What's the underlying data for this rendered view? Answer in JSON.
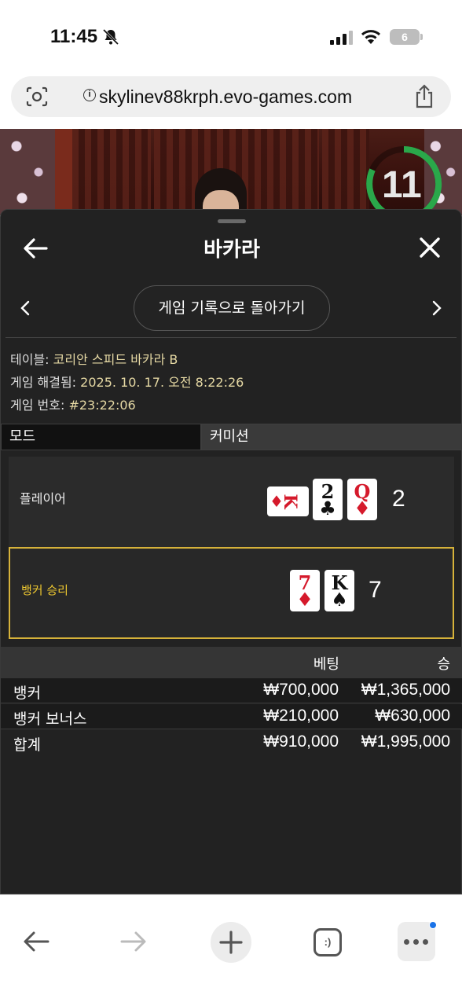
{
  "status_bar": {
    "time": "11:45",
    "battery": "6",
    "icons": [
      "bell-slash-icon",
      "signal-icon",
      "wifi-icon",
      "battery-icon"
    ]
  },
  "browser": {
    "url": "skylinev88krph.evo-games.com",
    "icons": [
      "camera-search-icon",
      "info-icon",
      "share-icon"
    ]
  },
  "video": {
    "timer": "11"
  },
  "sheet": {
    "title": "바카라",
    "history_button": "게임 기록으로 돌아가기",
    "info": {
      "table_label": "테이블:",
      "table_value": "코리안 스피드 바카라 B",
      "resolved_label": "게임 해결됨:",
      "resolved_value": "2025. 10. 17. 오전 8:22:26",
      "game_number_label": "게임 번호:",
      "game_number_value": "#23:22:06"
    },
    "mode": {
      "label": "모드",
      "value": "커미션"
    },
    "player": {
      "name": "플레이어",
      "score": "2",
      "cards": [
        {
          "rank": "K",
          "suit": "♦",
          "color": "#d5192b",
          "sideways": true
        },
        {
          "rank": "2",
          "suit": "♣",
          "color": "#111111",
          "sideways": false
        },
        {
          "rank": "Q",
          "suit": "♦",
          "color": "#d5192b",
          "sideways": false
        }
      ]
    },
    "banker": {
      "name": "뱅커 승리",
      "score": "7",
      "cards": [
        {
          "rank": "7",
          "suit": "♦",
          "color": "#d5192b",
          "sideways": false
        },
        {
          "rank": "K",
          "suit": "♠",
          "color": "#111111",
          "sideways": false
        }
      ]
    },
    "bets": {
      "header_bet": "베팅",
      "header_win": "승",
      "rows": [
        {
          "name": "뱅커",
          "bet": "₩700,000",
          "win": "₩1,365,000"
        },
        {
          "name": "뱅커 보너스",
          "bet": "₩210,000",
          "win": "₩630,000"
        },
        {
          "name": "합계",
          "bet": "₩910,000",
          "win": "₩1,995,000"
        }
      ]
    }
  },
  "toolbar": {
    "tabs_label": ":)",
    "icons": [
      "back-arrow-icon",
      "forward-arrow-icon",
      "plus-icon",
      "tabs-icon",
      "more-icon"
    ]
  },
  "colors": {
    "sheet_bg": "#222222",
    "winner_border": "#d6b23a",
    "winner_text": "#e9c430",
    "info_value": "#e6d9a4",
    "card_red": "#d5192b",
    "timer_ring": "#2aa84a"
  }
}
